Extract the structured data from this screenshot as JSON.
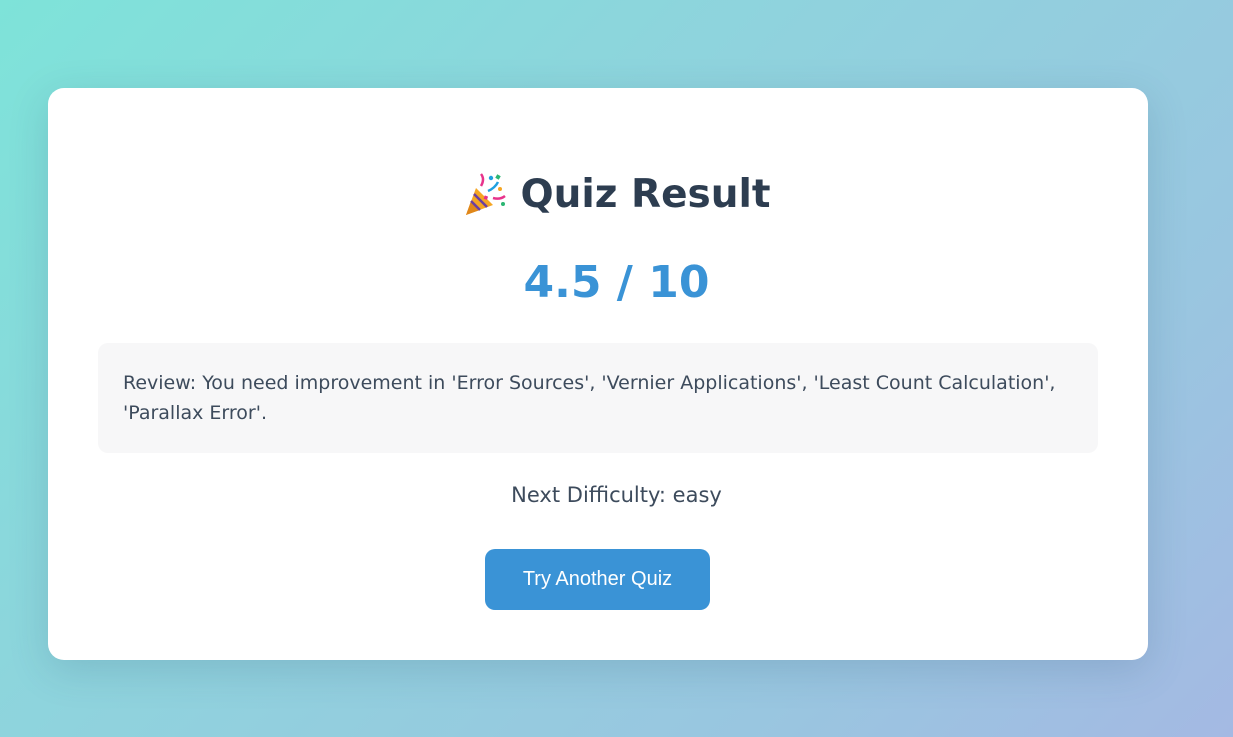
{
  "result": {
    "title_icon": "party-popper-icon",
    "title": "Quiz Result",
    "score": "4.5 / 10",
    "review": "Review: You need improvement in 'Error Sources', 'Vernier Applications', 'Least Count Calculation', 'Parallax Error'.",
    "next_difficulty": "Next Difficulty: easy",
    "button_label": "Try Another Quiz"
  },
  "colors": {
    "accent": "#3a93d6",
    "heading": "#2d3d50",
    "text": "#3d4b5c",
    "review_bg": "#f7f7f8",
    "background_start": "#7ee3d9",
    "background_end": "#a4b9e3"
  }
}
